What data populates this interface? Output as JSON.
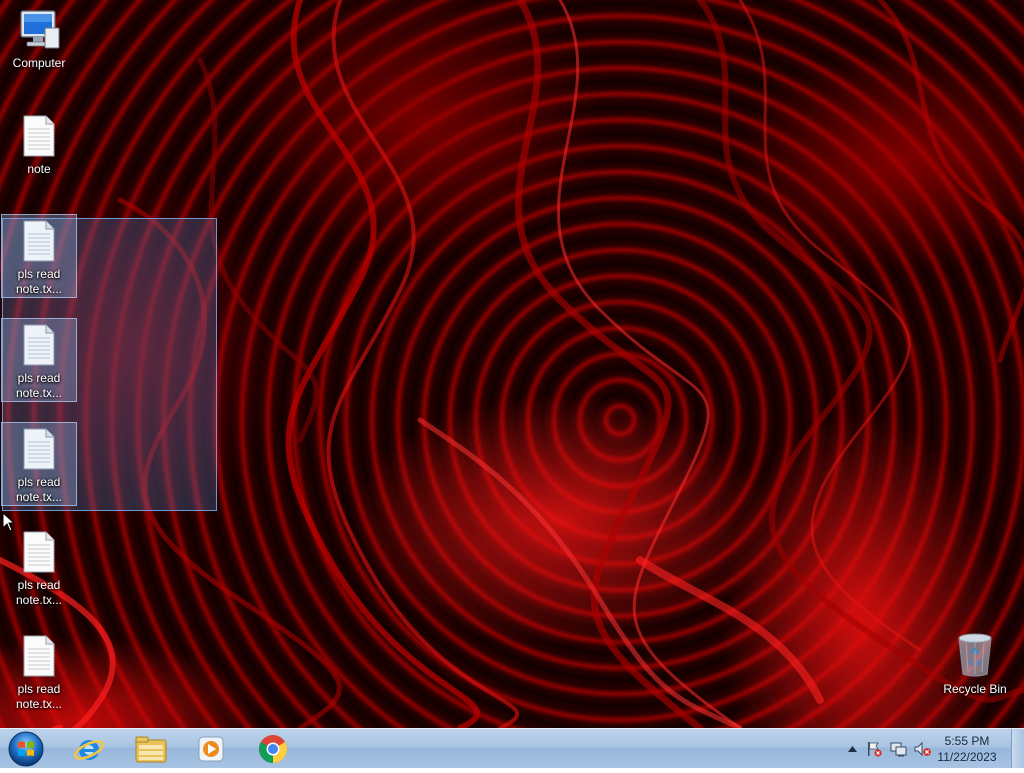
{
  "desktop": {
    "icons": [
      {
        "label": "Computer"
      },
      {
        "label": "note"
      },
      {
        "label": "pls read note.tx..."
      },
      {
        "label": "pls read note.tx..."
      },
      {
        "label": "pls read note.tx..."
      },
      {
        "label": "pls read note.tx..."
      },
      {
        "label": "pls read note.tx..."
      },
      {
        "label": "Recycle Bin"
      }
    ]
  },
  "taskbar": {
    "pinned": [
      {
        "icon": "internet-explorer-icon"
      },
      {
        "icon": "windows-explorer-icon"
      },
      {
        "icon": "windows-media-player-icon"
      },
      {
        "icon": "google-chrome-icon"
      }
    ],
    "tray": {
      "time": "5:55 PM",
      "date": "11/22/2023"
    }
  },
  "colors": {
    "taskbar": "#a9c4e2",
    "selection": "#5a8cd2",
    "wallpaper_red": "#d00000"
  }
}
